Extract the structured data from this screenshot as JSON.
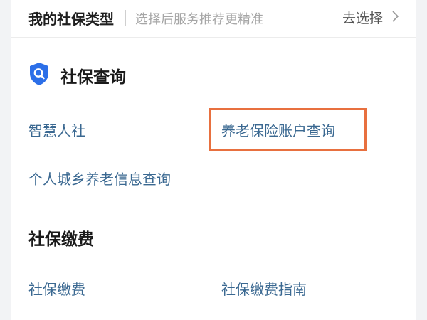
{
  "social_security_type": {
    "title": "我的社保类型",
    "hint": "选择后服务推荐更精准",
    "action_label": "去选择",
    "action_icon": "chevron-right-icon"
  },
  "query_section": {
    "icon": "shield-search-icon",
    "icon_color": "#2c6fe8",
    "title": "社保查询",
    "items": [
      {
        "label": "智慧人社"
      },
      {
        "label": "养老保险账户查询",
        "highlighted": true
      },
      {
        "label": "个人城乡养老信息查询"
      }
    ]
  },
  "payment_section": {
    "title": "社保缴费",
    "items": [
      {
        "label": "社保缴费"
      },
      {
        "label": "社保缴费指南"
      }
    ]
  },
  "colors": {
    "link": "#3a6891",
    "highlight_border": "#e8703f",
    "page_background": "#f2f3f5"
  }
}
